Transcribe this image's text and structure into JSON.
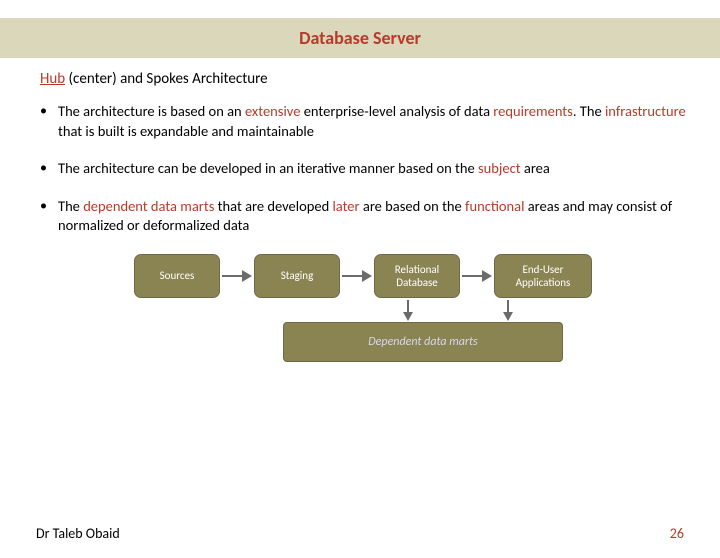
{
  "title": "Database Server",
  "subheading": {
    "hub": "Hub",
    "rest": " (center) and Spokes Architecture"
  },
  "bullets": {
    "b1": {
      "a": "The architecture is based on an ",
      "b": "extensive",
      "c": " enterprise-level analysis of data ",
      "d": "requirements",
      "e": ". The ",
      "f": "infrastructure",
      "g": " that is built is expandable and maintainable"
    },
    "b2": {
      "a": "The architecture can be developed in an iterative manner based on the ",
      "b": "subject",
      "c": " area"
    },
    "b3": {
      "a": "The ",
      "b": "dependent data marts",
      "c": " that are developed ",
      "d": "later",
      "e": " are based on the ",
      "f": "functional",
      "g": " areas and may consist of normalized or deformalized data"
    }
  },
  "diagram": {
    "sources": "Sources",
    "staging": "Staging",
    "reldb": "Relational\nDatabase",
    "enduser": "End-User\nApplications",
    "dependent": "Dependent data marts"
  },
  "footer": {
    "author": "Dr Taleb Obaid",
    "page": "26"
  }
}
